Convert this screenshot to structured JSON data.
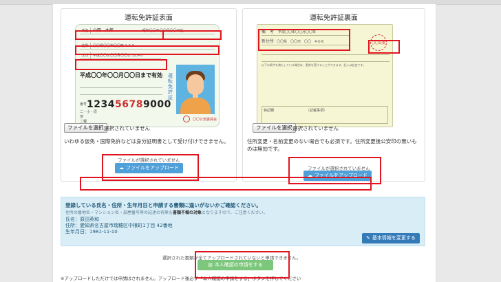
{
  "front": {
    "title": "運転免許証表面",
    "license": {
      "name_label": "氏名",
      "name_value": "山田　太郎",
      "birth_text": "昭和〇〇年〇〇月〇〇日生",
      "address_label": "住所",
      "address_value": "〇〇県〇〇市〇〇町 1-2-3",
      "issue_label": "交付",
      "issue_value": "平成〇〇年〇〇月〇〇日 12345",
      "valid_text": "平成〇〇年〇〇月〇〇日まで有効",
      "number_label": "番号",
      "number_black": "1234",
      "number_red": "5678",
      "number_tail": "9000",
      "vertical_text": "運転免許証",
      "lines": [
        "二・小・原",
        "他",
        "二種"
      ],
      "authority": "〇〇公安委員会"
    },
    "file_button": "ファイルを選択",
    "file_status": "選択されていません",
    "note": "いわゆる仮免・国際免許などは身分証明書として受け付けできません。",
    "upload_status": "ファイルが選択されていません",
    "upload_button": "ファイルをアップロード"
  },
  "back": {
    "title": "運転免許証裏面",
    "license": {
      "remarks_label": "備　考",
      "remarks_value": "平成〇〇年〇〇月〇〇日",
      "new_address_label": "新住所",
      "new_address_value": "〇〇県　〇〇市　〇〇　4-5-6",
      "stamp": "〇〇公安",
      "notes": "以下の条件を満たしている場合は、更新を受けることができます。記入は自由です。",
      "bottom_left": "特記欄",
      "bottom_right": "（記載事項）"
    },
    "file_button": "ファイルを選択",
    "file_status": "選択されていません",
    "note": "住所変更・名前変更のない場合でも必須です。住所変更後公安印の無いものは無効です。",
    "upload_status": "ファイルが選択されていません",
    "upload_button": "ファイルをアップロード"
  },
  "info": {
    "title": "登録している氏名・住所・生年月日と申請する書類に違いがないかご確認ください。",
    "subtitle_pre": "住所の番地名・マンション名・部屋番号等の記述の有無も",
    "subtitle_bold": "書類不備の対象",
    "subtitle_post": "となりますので、ご注意ください。",
    "name": "氏名：原田英和",
    "address": "住所：愛知県名古屋市瑞穂区中根町1丁目 42番地",
    "birthdate": "生年月日：1981-11-10",
    "change_button": "基本情報を変更する"
  },
  "submit": {
    "status": "選択された書類が全てアップロードされていないと申請できません。",
    "button": "本人確認の申請をする"
  },
  "footer": {
    "note": "※アップロードしただけでは申請はされません。アップロード後必ず「本人確認の申請をする」ボタンを押してください"
  },
  "colors": {
    "highlight_red": "#e0141e",
    "upload_blue": "#4f9fd9",
    "info_bg": "#d9edf7",
    "apply_green": "#7cc77b"
  }
}
